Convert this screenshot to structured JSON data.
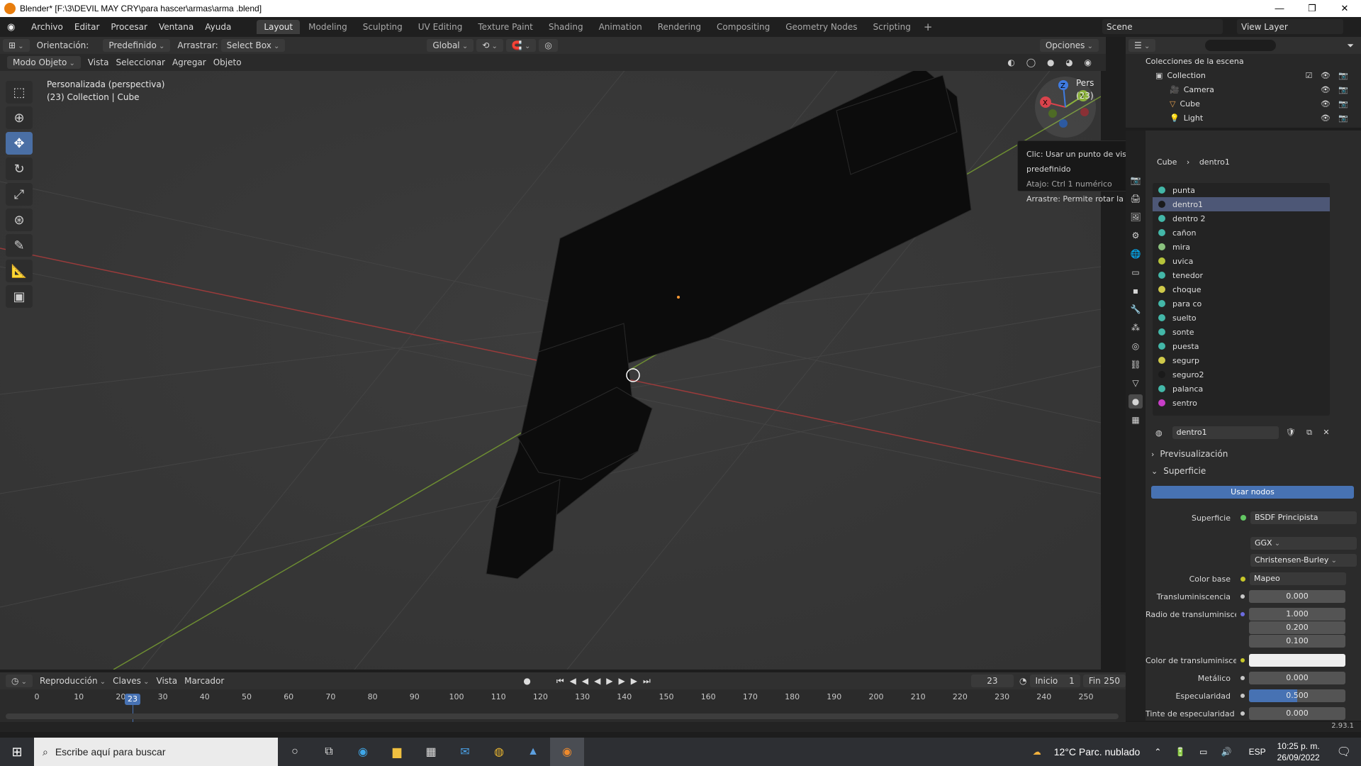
{
  "window": {
    "title": "Blender* [F:\\3\\DEVIL MAY CRY\\para hascer\\armas\\arma .blend]",
    "controls": [
      "—",
      "❐",
      "✕"
    ]
  },
  "menu": [
    "Archivo",
    "Editar",
    "Procesar",
    "Ventana",
    "Ayuda"
  ],
  "workspaces": [
    "Layout",
    "Modeling",
    "Sculpting",
    "UV Editing",
    "Texture Paint",
    "Shading",
    "Animation",
    "Rendering",
    "Compositing",
    "Geometry Nodes",
    "Scripting"
  ],
  "active_workspace": "Layout",
  "scene": "Scene",
  "view_layer": "View Layer",
  "viewport_header": {
    "orientation_label": "Orientación:",
    "orientation_value": "Predefinido",
    "drag_label": "Arrastrar:",
    "drag_value": "Select Box",
    "transform": "Global",
    "options": "Opciones"
  },
  "viewport_header2": {
    "mode": "Modo Objeto",
    "menus": [
      "Vista",
      "Seleccionar",
      "Agregar",
      "Objeto"
    ]
  },
  "viewport_info": {
    "line1": "Personalizada (perspectiva)",
    "line2": "(23) Collection | Cube",
    "right_cut": "Pers",
    "right_cut2": "(23)"
  },
  "tooltip": {
    "line1": "Clic: Usar un punto de vista predefinido",
    "line2": "Atajo: Ctrl 1 numérico",
    "line3": "Arrastre: Permite rotar la vista"
  },
  "gizmo": {
    "x": "X",
    "y": "Y",
    "z": "Z"
  },
  "outliner": {
    "root": "Colecciones de la escena",
    "collection": "Collection",
    "items": [
      "Camera",
      "Cube",
      "Light"
    ]
  },
  "properties": {
    "breadcrumb_obj": "Cube",
    "breadcrumb_mat": "dentro1",
    "materials": [
      {
        "name": "punta",
        "color": "#43b7a8"
      },
      {
        "name": "dentro1",
        "color": "#1a1a1a",
        "selected": true
      },
      {
        "name": "dentro 2",
        "color": "#43b7a8"
      },
      {
        "name": "cañon",
        "color": "#43b7a8"
      },
      {
        "name": "mira",
        "color": "#8bc27e"
      },
      {
        "name": "uvica",
        "color": "#b7c43a"
      },
      {
        "name": "tenedor",
        "color": "#43b7a8"
      },
      {
        "name": "choque",
        "color": "#cfc94a"
      },
      {
        "name": "para co",
        "color": "#43b7a8"
      },
      {
        "name": "suelto",
        "color": "#43b7a8"
      },
      {
        "name": "sonte",
        "color": "#43b7a8"
      },
      {
        "name": "puesta",
        "color": "#43b7a8"
      },
      {
        "name": "segurp",
        "color": "#cfc94a"
      },
      {
        "name": "seguro2",
        "color": "#1a1a1a"
      },
      {
        "name": "palanca",
        "color": "#43b7a8"
      },
      {
        "name": "sentro",
        "color": "#c83ec8"
      }
    ],
    "material_slot": "dentro1",
    "section_preview": "Previsualización",
    "section_surface": "Superficie",
    "use_nodes": "Usar nodos",
    "surface_label": "Superficie",
    "surface_value": "BSDF Principista",
    "distribution": "GGX",
    "subsurface_method": "Christensen-Burley",
    "rows": [
      {
        "label": "Color base",
        "value": "Mapeo"
      },
      {
        "label": "Transluminiscencia",
        "value": "0.000"
      },
      {
        "label": "Radio de transluminiscencia",
        "value": "1.000"
      },
      {
        "label": "",
        "value": "0.200"
      },
      {
        "label": "",
        "value": "0.100"
      },
      {
        "label": "Color de transluminiscencia",
        "value": ""
      },
      {
        "label": "Metálico",
        "value": "0.000"
      },
      {
        "label": "Especularidad",
        "value": "0.500"
      },
      {
        "label": "Tinte de especularidad",
        "value": "0.000"
      }
    ]
  },
  "timeline": {
    "menus": [
      "Reproducción",
      "Claves",
      "Vista",
      "Marcador"
    ],
    "current_frame": "23",
    "start_label": "Inicio",
    "start": "1",
    "end_label": "Fin",
    "end": "250",
    "ticks": [
      "0",
      "10",
      "20",
      "30",
      "40",
      "50",
      "60",
      "70",
      "80",
      "90",
      "100",
      "110",
      "120",
      "130",
      "140",
      "150",
      "160",
      "170",
      "180",
      "190",
      "200",
      "210",
      "220",
      "230",
      "240",
      "250"
    ]
  },
  "statusbar": {
    "version": "2.93.1"
  },
  "taskbar": {
    "search_placeholder": "Escribe aquí para buscar",
    "weather": "12°C  Parc. nublado",
    "lang": "ESP",
    "time": "10:25 p. m.",
    "date": "26/09/2022"
  }
}
